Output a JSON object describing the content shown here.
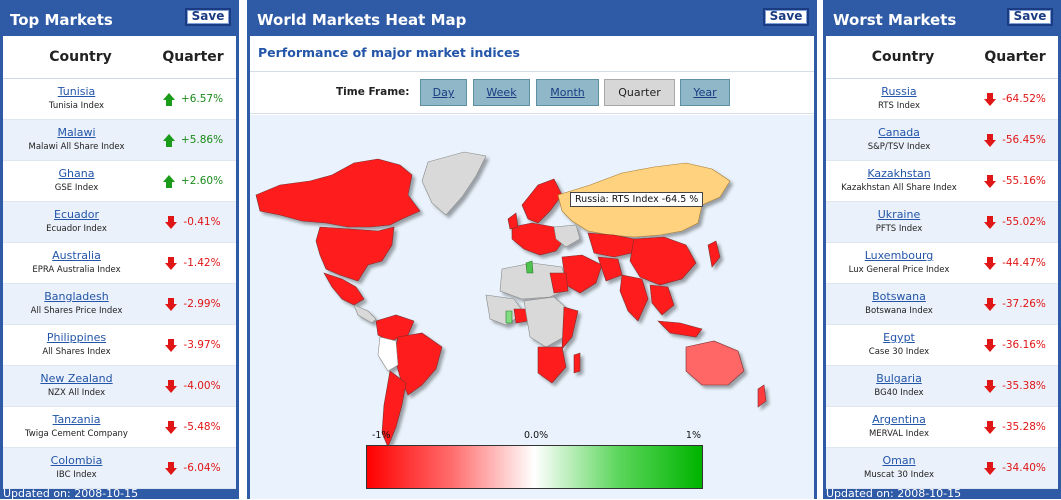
{
  "left": {
    "title": "Top Markets",
    "save_label": "Save",
    "col_country": "Country",
    "col_quarter": "Quarter",
    "updated": "Updated on: 2008-10-15",
    "rows": [
      {
        "country": "Tunisia",
        "index": "Tunisia Index",
        "value": "+6.57%",
        "dir": "up"
      },
      {
        "country": "Malawi",
        "index": "Malawi All Share Index",
        "value": "+5.86%",
        "dir": "up"
      },
      {
        "country": "Ghana",
        "index": "GSE Index",
        "value": "+2.60%",
        "dir": "up"
      },
      {
        "country": "Ecuador",
        "index": "Ecuador Index",
        "value": "-0.41%",
        "dir": "down"
      },
      {
        "country": "Australia",
        "index": "EPRA Australia Index",
        "value": "-1.42%",
        "dir": "down"
      },
      {
        "country": "Bangladesh",
        "index": "All Shares Price Index",
        "value": "-2.99%",
        "dir": "down"
      },
      {
        "country": "Philippines",
        "index": "All Shares Index",
        "value": "-3.97%",
        "dir": "down"
      },
      {
        "country": "New Zealand",
        "index": "NZX All Index",
        "value": "-4.00%",
        "dir": "down"
      },
      {
        "country": "Tanzania",
        "index": "Twiga Cement Company",
        "value": "-5.48%",
        "dir": "down"
      },
      {
        "country": "Colombia",
        "index": "IBC Index",
        "value": "-6.04%",
        "dir": "down"
      }
    ]
  },
  "center": {
    "title": "World Markets Heat Map",
    "save_label": "Save",
    "subtitle": "Performance of major market indices",
    "timeframe_label": "Time Frame:",
    "timeframes": [
      "Day",
      "Week",
      "Month",
      "Quarter",
      "Year"
    ],
    "active_timeframe": "Quarter",
    "tooltip": "Russia: RTS Index -64.5 %",
    "legend": {
      "min": "-1%",
      "mid": "0.0%",
      "max": "1%"
    },
    "colors": {
      "negative": "#ff0000",
      "neutral": "#ffffff",
      "positive": "#00b400",
      "nodata": "#d9d9d9",
      "highlight": "#ffd27f"
    }
  },
  "right": {
    "title": "Worst Markets",
    "save_label": "Save",
    "col_country": "Country",
    "col_quarter": "Quarter",
    "updated": "Updated on: 2008-10-15",
    "rows": [
      {
        "country": "Russia",
        "index": "RTS Index",
        "value": "-64.52%",
        "dir": "down"
      },
      {
        "country": "Canada",
        "index": "S&P/TSV Index",
        "value": "-56.45%",
        "dir": "down"
      },
      {
        "country": "Kazakhstan",
        "index": "Kazakhstan All Share Index",
        "value": "-55.16%",
        "dir": "down"
      },
      {
        "country": "Ukraine",
        "index": "PFTS Index",
        "value": "-55.02%",
        "dir": "down"
      },
      {
        "country": "Luxembourg",
        "index": "Lux General Price Index",
        "value": "-44.47%",
        "dir": "down"
      },
      {
        "country": "Botswana",
        "index": "Botswana Index",
        "value": "-37.26%",
        "dir": "down"
      },
      {
        "country": "Egypt",
        "index": "Case 30 Index",
        "value": "-36.16%",
        "dir": "down"
      },
      {
        "country": "Bulgaria",
        "index": "BG40 Index",
        "value": "-35.38%",
        "dir": "down"
      },
      {
        "country": "Argentina",
        "index": "MERVAL Index",
        "value": "-35.28%",
        "dir": "down"
      },
      {
        "country": "Oman",
        "index": "Muscat 30 Index",
        "value": "-34.40%",
        "dir": "down"
      }
    ]
  }
}
